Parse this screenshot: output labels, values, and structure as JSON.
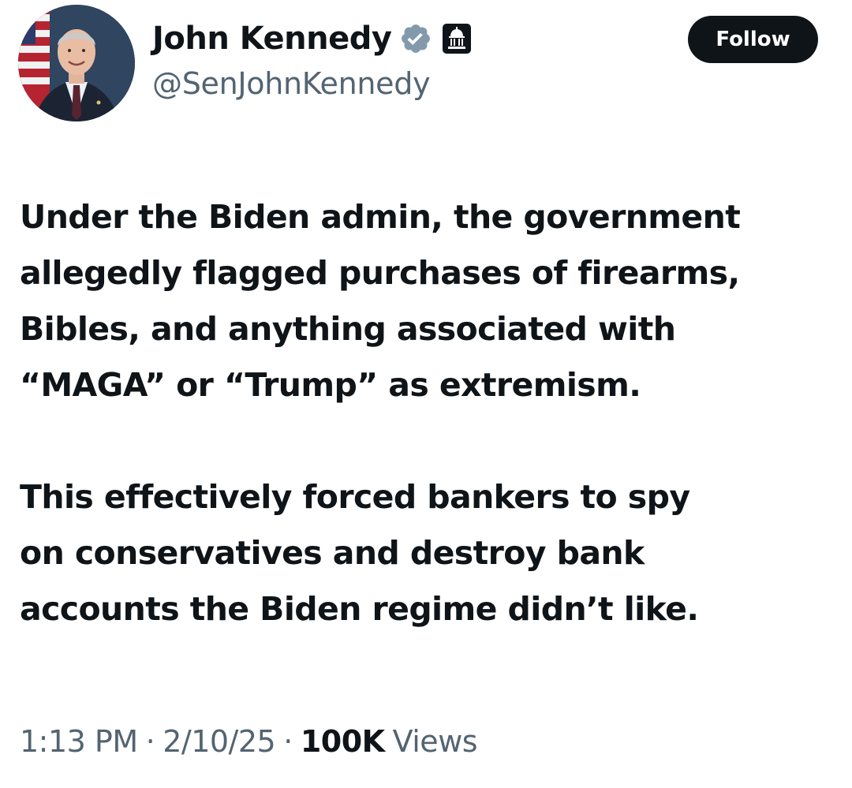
{
  "author": {
    "display_name": "John Kennedy",
    "handle": "@SenJohnKennedy",
    "avatar_icon": "profile-photo",
    "verified_icon": "verified-badge-icon",
    "affiliation_icon": "government-building-icon"
  },
  "follow_button": {
    "label": "Follow"
  },
  "tweet": {
    "paragraph_1_lines": [
      "Under the Biden admin, the government",
      "allegedly flagged purchases of firearms,",
      "Bibles, and anything associated with",
      "“MAGA” or “Trump” as extremism."
    ],
    "paragraph_2_lines": [
      "This effectively forced bankers to spy",
      "on conservatives and destroy bank",
      "accounts the Biden regime didn’t like."
    ]
  },
  "meta": {
    "time": "1:13 PM",
    "separator": "·",
    "date": "2/10/25",
    "views_count": "100K",
    "views_label": "Views"
  },
  "colors": {
    "text_primary": "#0f1419",
    "text_secondary": "#536471",
    "verified_badge": "#829aab",
    "follow_button_bg": "#0f1419",
    "follow_button_text": "#ffffff"
  }
}
